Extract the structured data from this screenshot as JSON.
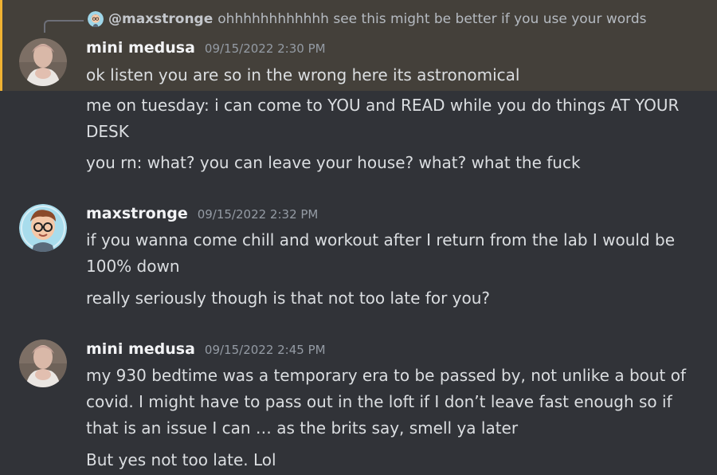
{
  "reply": {
    "author": "@maxstronge",
    "text": "ohhhhhhhhhhhh see this might be better if you use your words"
  },
  "messages": [
    {
      "author": "mini medusa",
      "timestamp": "09/15/2022 2:30 PM",
      "lines": [
        "ok listen you are so in the wrong here its astronomical",
        "me on tuesday: i can come to YOU and READ while you do things AT YOUR DESK",
        "you rn: what? you can leave your house? what? what the fuck"
      ]
    },
    {
      "author": "maxstronge",
      "timestamp": "09/15/2022 2:32 PM",
      "lines": [
        "if you wanna come chill and workout after I return from the lab I would be 100% down",
        "really seriously though is that not too late for you?"
      ]
    },
    {
      "author": "mini medusa",
      "timestamp": "09/15/2022 2:45 PM",
      "lines": [
        "my 930 bedtime was a temporary era to be passed by, not unlike a bout of covid. I might have to pass out in the loft if I don’t leave fast enough so if that is an issue I can … as the brits say, smell ya later",
        "But yes not too late. Lol"
      ]
    }
  ],
  "colors": {
    "background": "#313338",
    "highlight": "#44403a",
    "highlight_border": "#f0b232",
    "author": "#f2f3f5",
    "timestamp": "#949ba4",
    "text": "#dbdee1"
  }
}
